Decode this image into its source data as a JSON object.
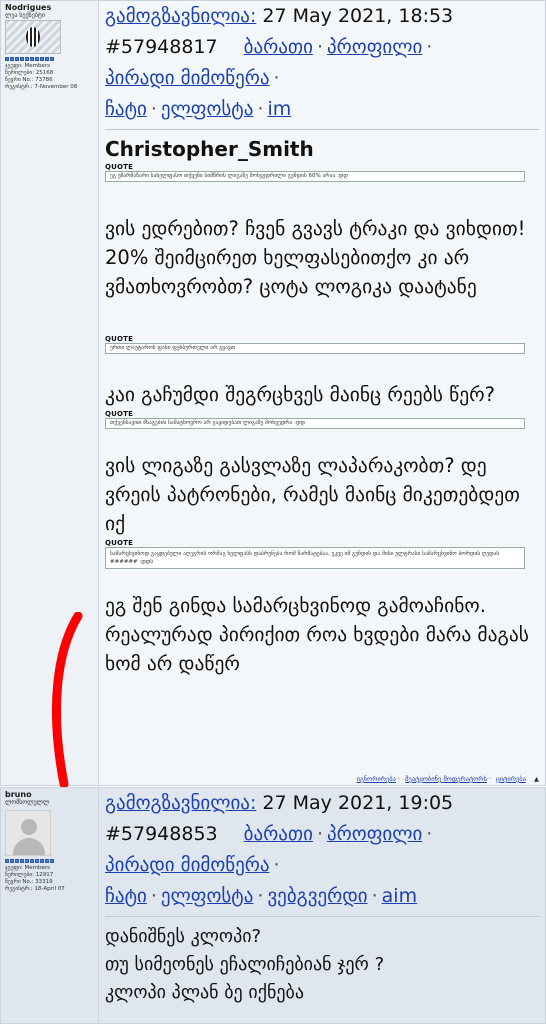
{
  "post1": {
    "author": {
      "name": "Nodrigues",
      "title": "ლეა სექსებტი",
      "group": "ჯგუფი: Members",
      "posts": "წერილები: 25168",
      "member_no": "წევრი No.: 73786",
      "registered": "რეგისტრ.: 7-November 08"
    },
    "sent_label": "გამოგზავნილია:",
    "date": "27 May 2021, 18:53",
    "post_id": "#57948817",
    "links": {
      "karati": "ბარათი",
      "profile": "პროფილი",
      "pm": "პირადი მიმოწერა",
      "chat": "ჩატი",
      "email": "ელფოსტა",
      "im": "im"
    },
    "quoted_user": "Christopher_Smith",
    "quote_label": "QUOTE",
    "quote1": "ეგ უზარმაზარი სახელფასო თქვენი სიმწრის ლიგაზე მოხვედრილი გუნდის 60% არაა :დდ",
    "reply1": "ვის ედრებით? ჩვენ გვავს ტრაკი და ვიხდით! 20% შეიმცირეთ ხელფასებითქო კი არ ვმათხოვრობთ? ცოტა ლოგიკა დაატანე",
    "quote2": "ერთი ლაუტაროს ფასი ფეხბურთელი არ გყავთ",
    "reply2": "კაი გაჩუმდი შეგრცხვეს მაინც რეებს წერ?",
    "quote3": "თქვენსავით მსაგების სამატხოვრო არ გაყიდებათ ლიგაზე მოხვედრა :დდ",
    "reply3": "ვის ლიგაზე გასვლაზე ლაპარაკობთ? დე ვრეის პატრონები, რამეს მაინც მიკეთებდეთ იქ",
    "quote4": "სამარცხვინოდ გაყდებული აღეგრის ორმაგ ხელფასს დაბრუნება რომ წარმატებაა, უკვე იმ გუნდის და მისი ულტრასი სამარცხვინო ბორდის ღედას ###### :დდს",
    "reply4": "ეგ შენ გინდა სამარცხვინოდ გამოაჩინო. რეალურად პირიქით როა ხვდები მარა მაგას ხომ არ დაწერ",
    "footer": {
      "ignore": "იგნორირება",
      "report": "შეატყობინე მოდერატორს",
      "quote": "ციტირება"
    }
  },
  "post2": {
    "author": {
      "name": "bruno",
      "title": "ლომსოლულლ",
      "group": "ჯგუფი: Members",
      "posts": "წერილები: 12917",
      "member_no": "წევრი No.: 33319",
      "registered": "რეგისტრ.: 18-April 07"
    },
    "sent_label": "გამოგზავნილია:",
    "date": "27 May 2021, 19:05",
    "post_id": "#57948853",
    "links": {
      "karati": "ბარათი",
      "profile": "პროფილი",
      "pm": "პირადი მიმოწერა",
      "chat": "ჩატი",
      "email": "ელფოსტა",
      "website": "ვებგვერდი",
      "aim": "aim"
    },
    "line1": "დანიშნეს კლოპი?",
    "line2": "თუ სიმეონეს ეჩალიჩებიან ჯერ ?",
    "line3": "კლოპი პლან ბე იქნება"
  },
  "colors": {
    "link": "#1a3fb0",
    "post1_bg": "#f4f7fa",
    "post2_bg": "#dfe6ee",
    "annotation": "#ff0000"
  },
  "icons": [
    "arrow-up-icon",
    "default-avatar-icon",
    "rank-pip-icon"
  ]
}
